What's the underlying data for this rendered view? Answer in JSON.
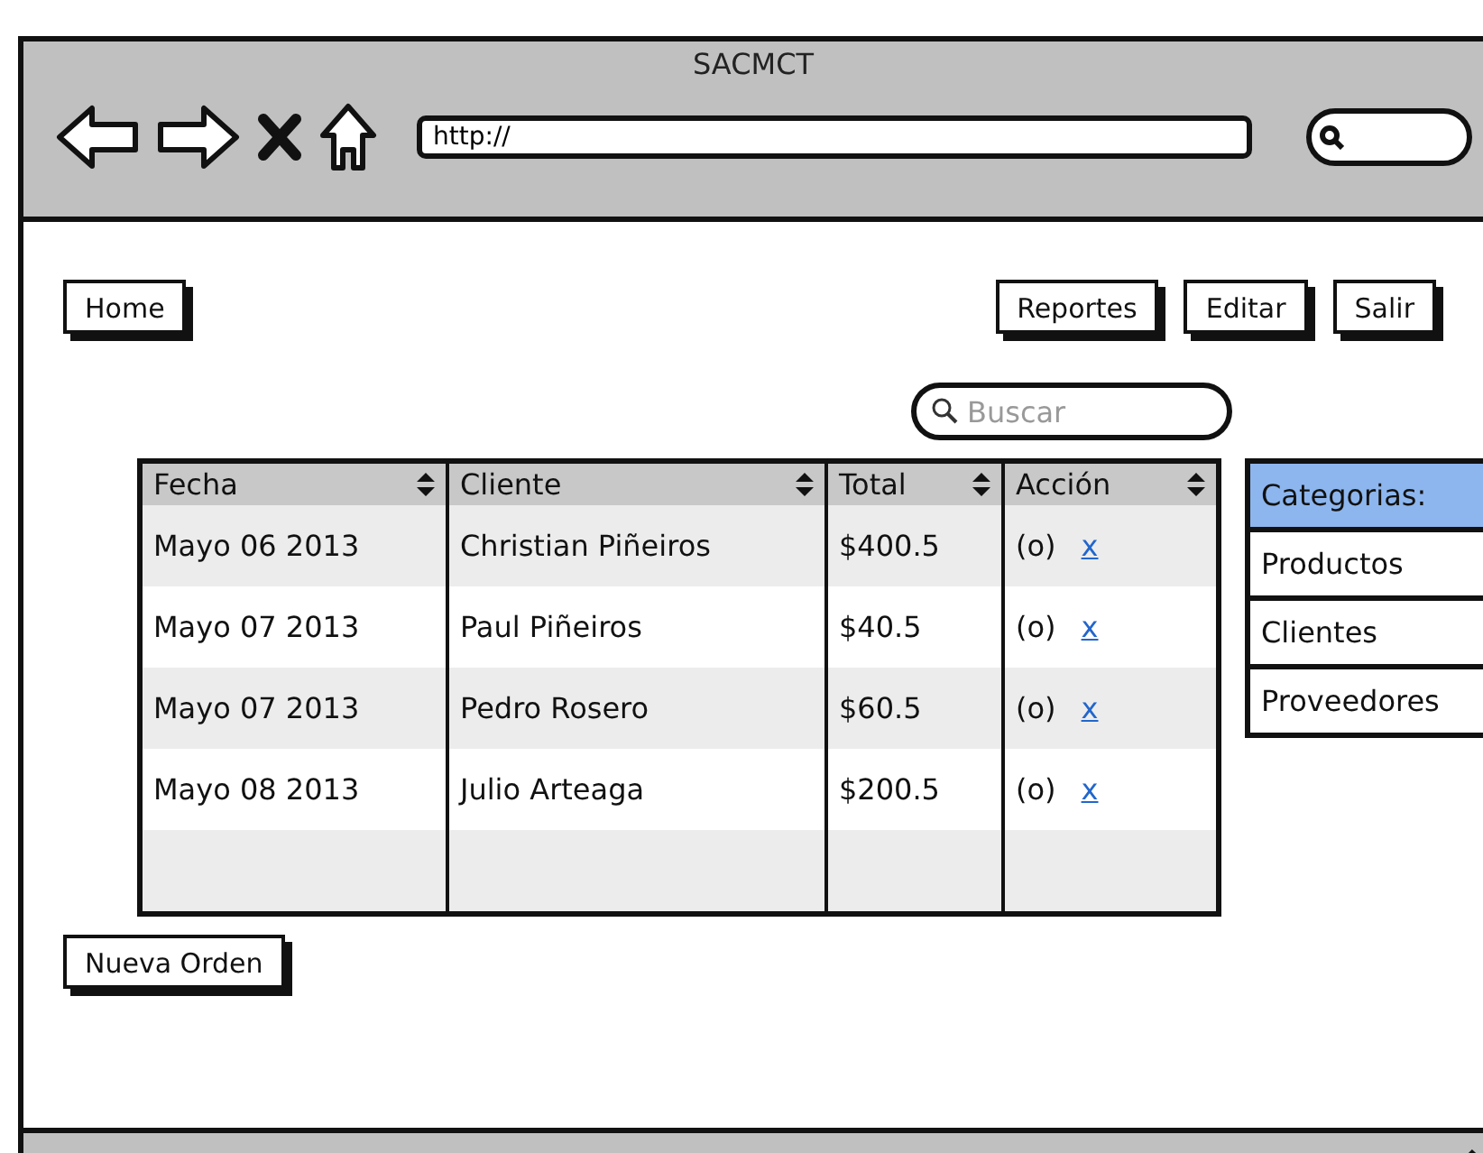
{
  "window": {
    "title": "SACMCT",
    "url": "http://"
  },
  "nav_left": [
    {
      "label": "Home"
    }
  ],
  "nav_right": [
    {
      "label": "Reportes"
    },
    {
      "label": "Editar"
    },
    {
      "label": "Salir"
    }
  ],
  "search": {
    "placeholder": "Buscar"
  },
  "table": {
    "columns": [
      "Fecha",
      "Cliente",
      "Total",
      "Acción"
    ],
    "rows": [
      {
        "fecha": "Mayo 06 2013",
        "cliente": "Christian Piñeiros",
        "total": "$400.5",
        "view": "(o)",
        "delete": "x"
      },
      {
        "fecha": "Mayo 07 2013",
        "cliente": "Paul Piñeiros",
        "total": "$40.5",
        "view": "(o)",
        "delete": "x"
      },
      {
        "fecha": "Mayo 07 2013",
        "cliente": "Pedro Rosero",
        "total": "$60.5",
        "view": "(o)",
        "delete": "x"
      },
      {
        "fecha": "Mayo 08 2013",
        "cliente": "Julio Arteaga",
        "total": "$200.5",
        "view": "(o)",
        "delete": "x"
      }
    ]
  },
  "categories": {
    "title": "Categorias:",
    "items": [
      "Productos",
      "Clientes",
      "Proveedores"
    ]
  },
  "new_order_button": "Nueva Orden"
}
